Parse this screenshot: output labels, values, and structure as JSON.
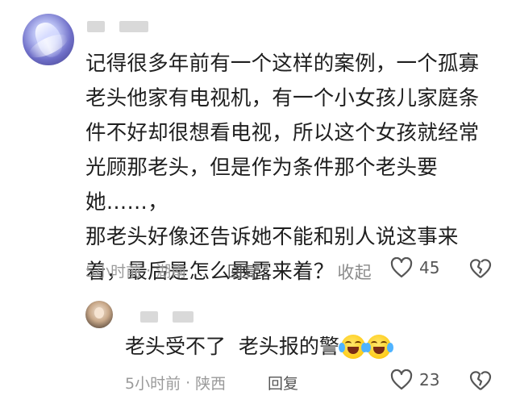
{
  "comment": {
    "text_lines": [
      "记得很多年前有一个这样的案例，一个孤寡",
      "老头他家有电视机，有一个小女孩儿家庭条",
      "件不好却很想看电视，所以这个女孩就经常",
      "光顾那老头，但是作为条件那个老头要她……，",
      "那老头好像还告诉她不能和别人说这事来",
      "着，最后是怎么暴露来着？"
    ],
    "collapse_label": "收起",
    "time": "5小时前",
    "separator": "·",
    "location": "湖南",
    "reply_label": "回复",
    "like_count": "45"
  },
  "reply": {
    "text": "老头受不了  老头报的警",
    "emoji": "rolling-on-floor-laughing",
    "time": "5小时前",
    "separator": "·",
    "location": "陕西",
    "reply_label": "回复",
    "like_count": "23"
  },
  "colors": {
    "text": "#1f1f1f",
    "meta": "#9a9a9a",
    "action": "#555555",
    "blur": "#d9d9d9"
  }
}
